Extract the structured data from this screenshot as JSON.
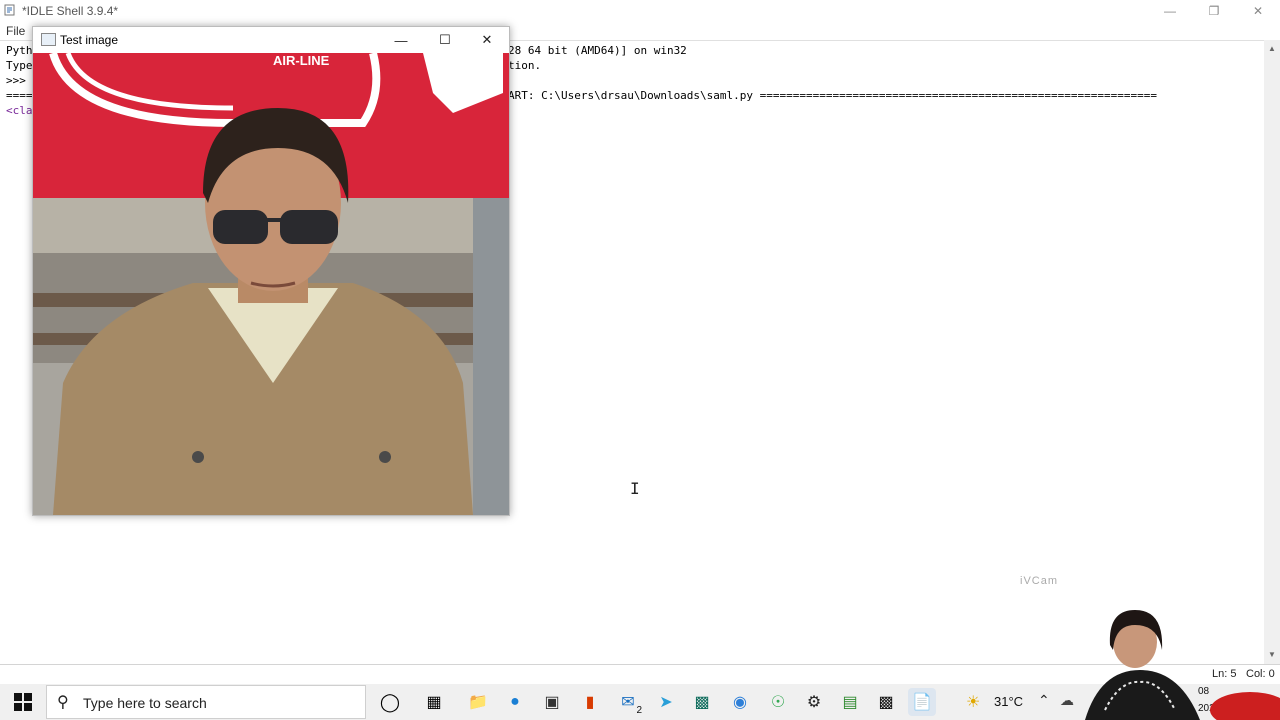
{
  "idle": {
    "title": "*IDLE Shell 3.9.4*",
    "menu_file": "File",
    "lines": {
      "l1_left": "Pyth",
      "l1_right": "28 64 bit (AMD64)] on win32",
      "l2_left": "Type",
      "l2_right": "tion.",
      "l3_left": ">>>",
      "l4_left": "====",
      "l4_right": "ART: C:\\Users\\drsau\\Downloads\\saml.py ============================================================",
      "l5_left": "<cla"
    },
    "status_ln": "Ln: 5",
    "status_col": "Col: 0",
    "watermark": "iVCam"
  },
  "image_window": {
    "title": "Test image",
    "billboard_text": "AIR-LINE"
  },
  "taskbar": {
    "search_placeholder": "Type here to search",
    "temperature": "31°C",
    "mail_badge": "2",
    "clock_partial": "08",
    "date_partial": "202"
  },
  "colors": {
    "billboard_red": "#d8253a",
    "jacket": "#a58a66",
    "taskbar_bg": "#f0f0f0"
  }
}
